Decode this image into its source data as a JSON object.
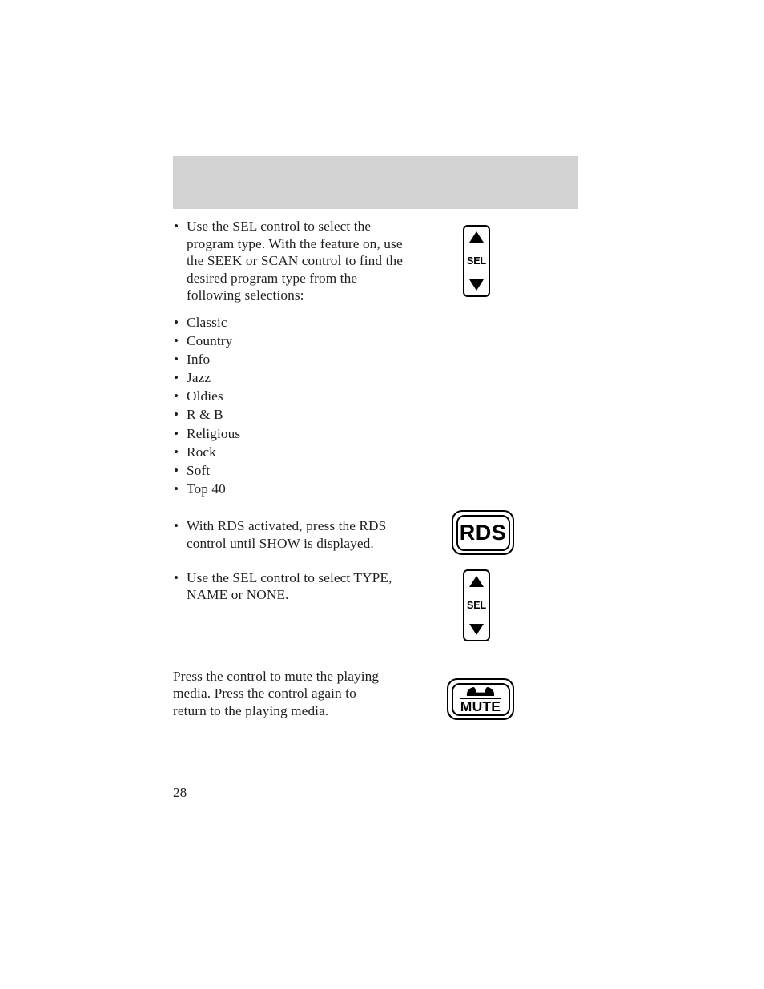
{
  "page": {
    "number": "28",
    "header_band": {
      "text": ""
    }
  },
  "sections": [
    {
      "id": "program-type",
      "bullets": [
        "Use the SEL control to select the program type. With the feature on, use the SEEK or SCAN control to find the desired program type from the following selections:"
      ],
      "control": {
        "type": "sel-rocker",
        "label": "SEL"
      }
    },
    {
      "id": "rds-show",
      "bullets": [
        "With RDS activated, press the RDS control until SHOW is displayed."
      ],
      "control": {
        "type": "push-button",
        "label": "RDS"
      }
    },
    {
      "id": "rds-select",
      "bullets": [
        "Use the SEL control to select TYPE, NAME or NONE."
      ],
      "control": {
        "type": "sel-rocker",
        "label": "SEL"
      }
    },
    {
      "id": "mute",
      "paragraph": "Press the control to mute the playing media. Press the control again to return to the playing media.",
      "control": {
        "type": "push-button",
        "label": "MUTE",
        "icon": "phone-handset-icon"
      }
    }
  ],
  "program_types": [
    "Classic",
    "Country",
    "Info",
    "Jazz",
    "Oldies",
    "R & B",
    "Religious",
    "Rock",
    "Soft",
    "Top 40"
  ],
  "bullet_glyph": "•",
  "colors": {
    "page_background": "#ffffff",
    "header_band": "#d2d2d2",
    "text": "#231f20",
    "control_outline": "#000000"
  }
}
